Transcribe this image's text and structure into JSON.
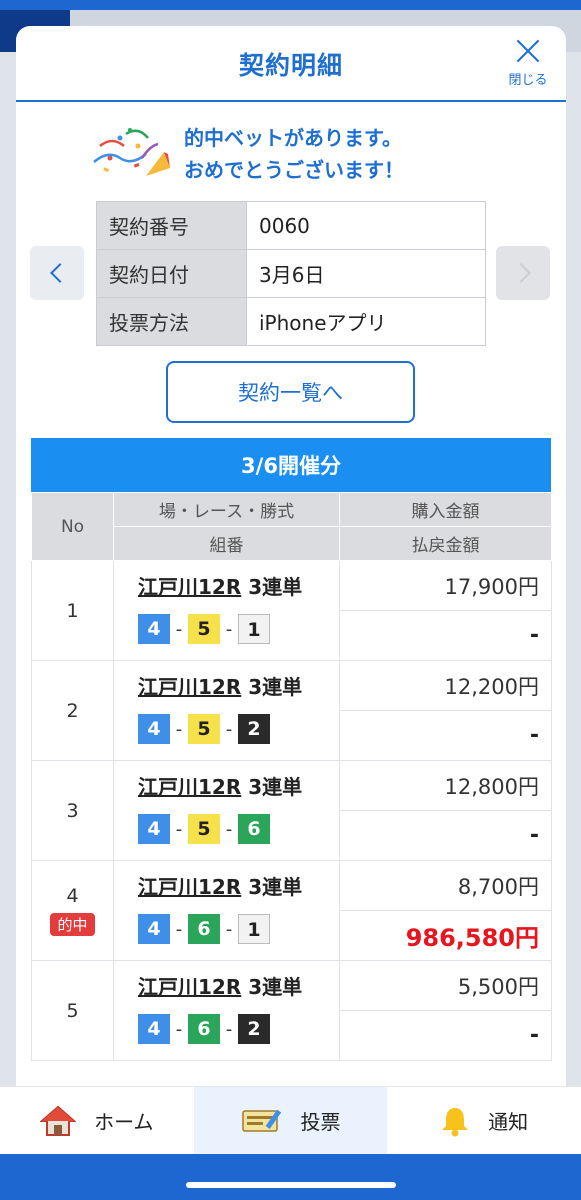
{
  "modal": {
    "title": "契約明細",
    "close_label": "閉じる"
  },
  "congrats": {
    "line1": "的中ベットがあります。",
    "line2": "おめでとうございます！"
  },
  "info": {
    "rows": [
      {
        "key": "契約番号",
        "value": "0060"
      },
      {
        "key": "契約日付",
        "value": "3月6日"
      },
      {
        "key": "投票方法",
        "value": "iPhoneアプリ"
      }
    ]
  },
  "list_button": "契約一覧へ",
  "date_header": "3/6開催分",
  "table": {
    "headers": {
      "no": "No",
      "race": "場・レース・勝式",
      "combo": "組番",
      "purchase": "購入金額",
      "payout": "払戻金額"
    },
    "hit_label": "的中",
    "rows": [
      {
        "no": "1",
        "venue": "江戸川12R",
        "type": "3連単",
        "b1": "4",
        "b2": "5",
        "b3": "1",
        "purchase": "17,900円",
        "payout": "-"
      },
      {
        "no": "2",
        "venue": "江戸川12R",
        "type": "3連単",
        "b1": "4",
        "b2": "5",
        "b3": "2",
        "purchase": "12,200円",
        "payout": "-"
      },
      {
        "no": "3",
        "venue": "江戸川12R",
        "type": "3連単",
        "b1": "4",
        "b2": "5",
        "b3": "6",
        "purchase": "12,800円",
        "payout": "-"
      },
      {
        "no": "4",
        "venue": "江戸川12R",
        "type": "3連単",
        "b1": "4",
        "b2": "6",
        "b3": "1",
        "purchase": "8,700円",
        "payout": "986,580円"
      },
      {
        "no": "5",
        "venue": "江戸川12R",
        "type": "3連単",
        "b1": "4",
        "b2": "6",
        "b3": "2",
        "purchase": "5,500円",
        "payout": "-"
      }
    ]
  },
  "boat_colors": {
    "1": {
      "bg": "#f2f2f2",
      "fg": "#222222"
    },
    "2": {
      "bg": "#2a2a2a",
      "fg": "#ffffff"
    },
    "4": {
      "bg": "#3f8fe8",
      "fg": "#ffffff"
    },
    "5": {
      "bg": "#f7e14b",
      "fg": "#222222"
    },
    "6": {
      "bg": "#2aa55a",
      "fg": "#ffffff"
    }
  },
  "tabbar": {
    "home": "ホーム",
    "vote": "投票",
    "notify": "通知"
  },
  "colors": {
    "accent": "#1f6fd1",
    "date_bar": "#1b8ef2",
    "hit": "#e8141e"
  }
}
